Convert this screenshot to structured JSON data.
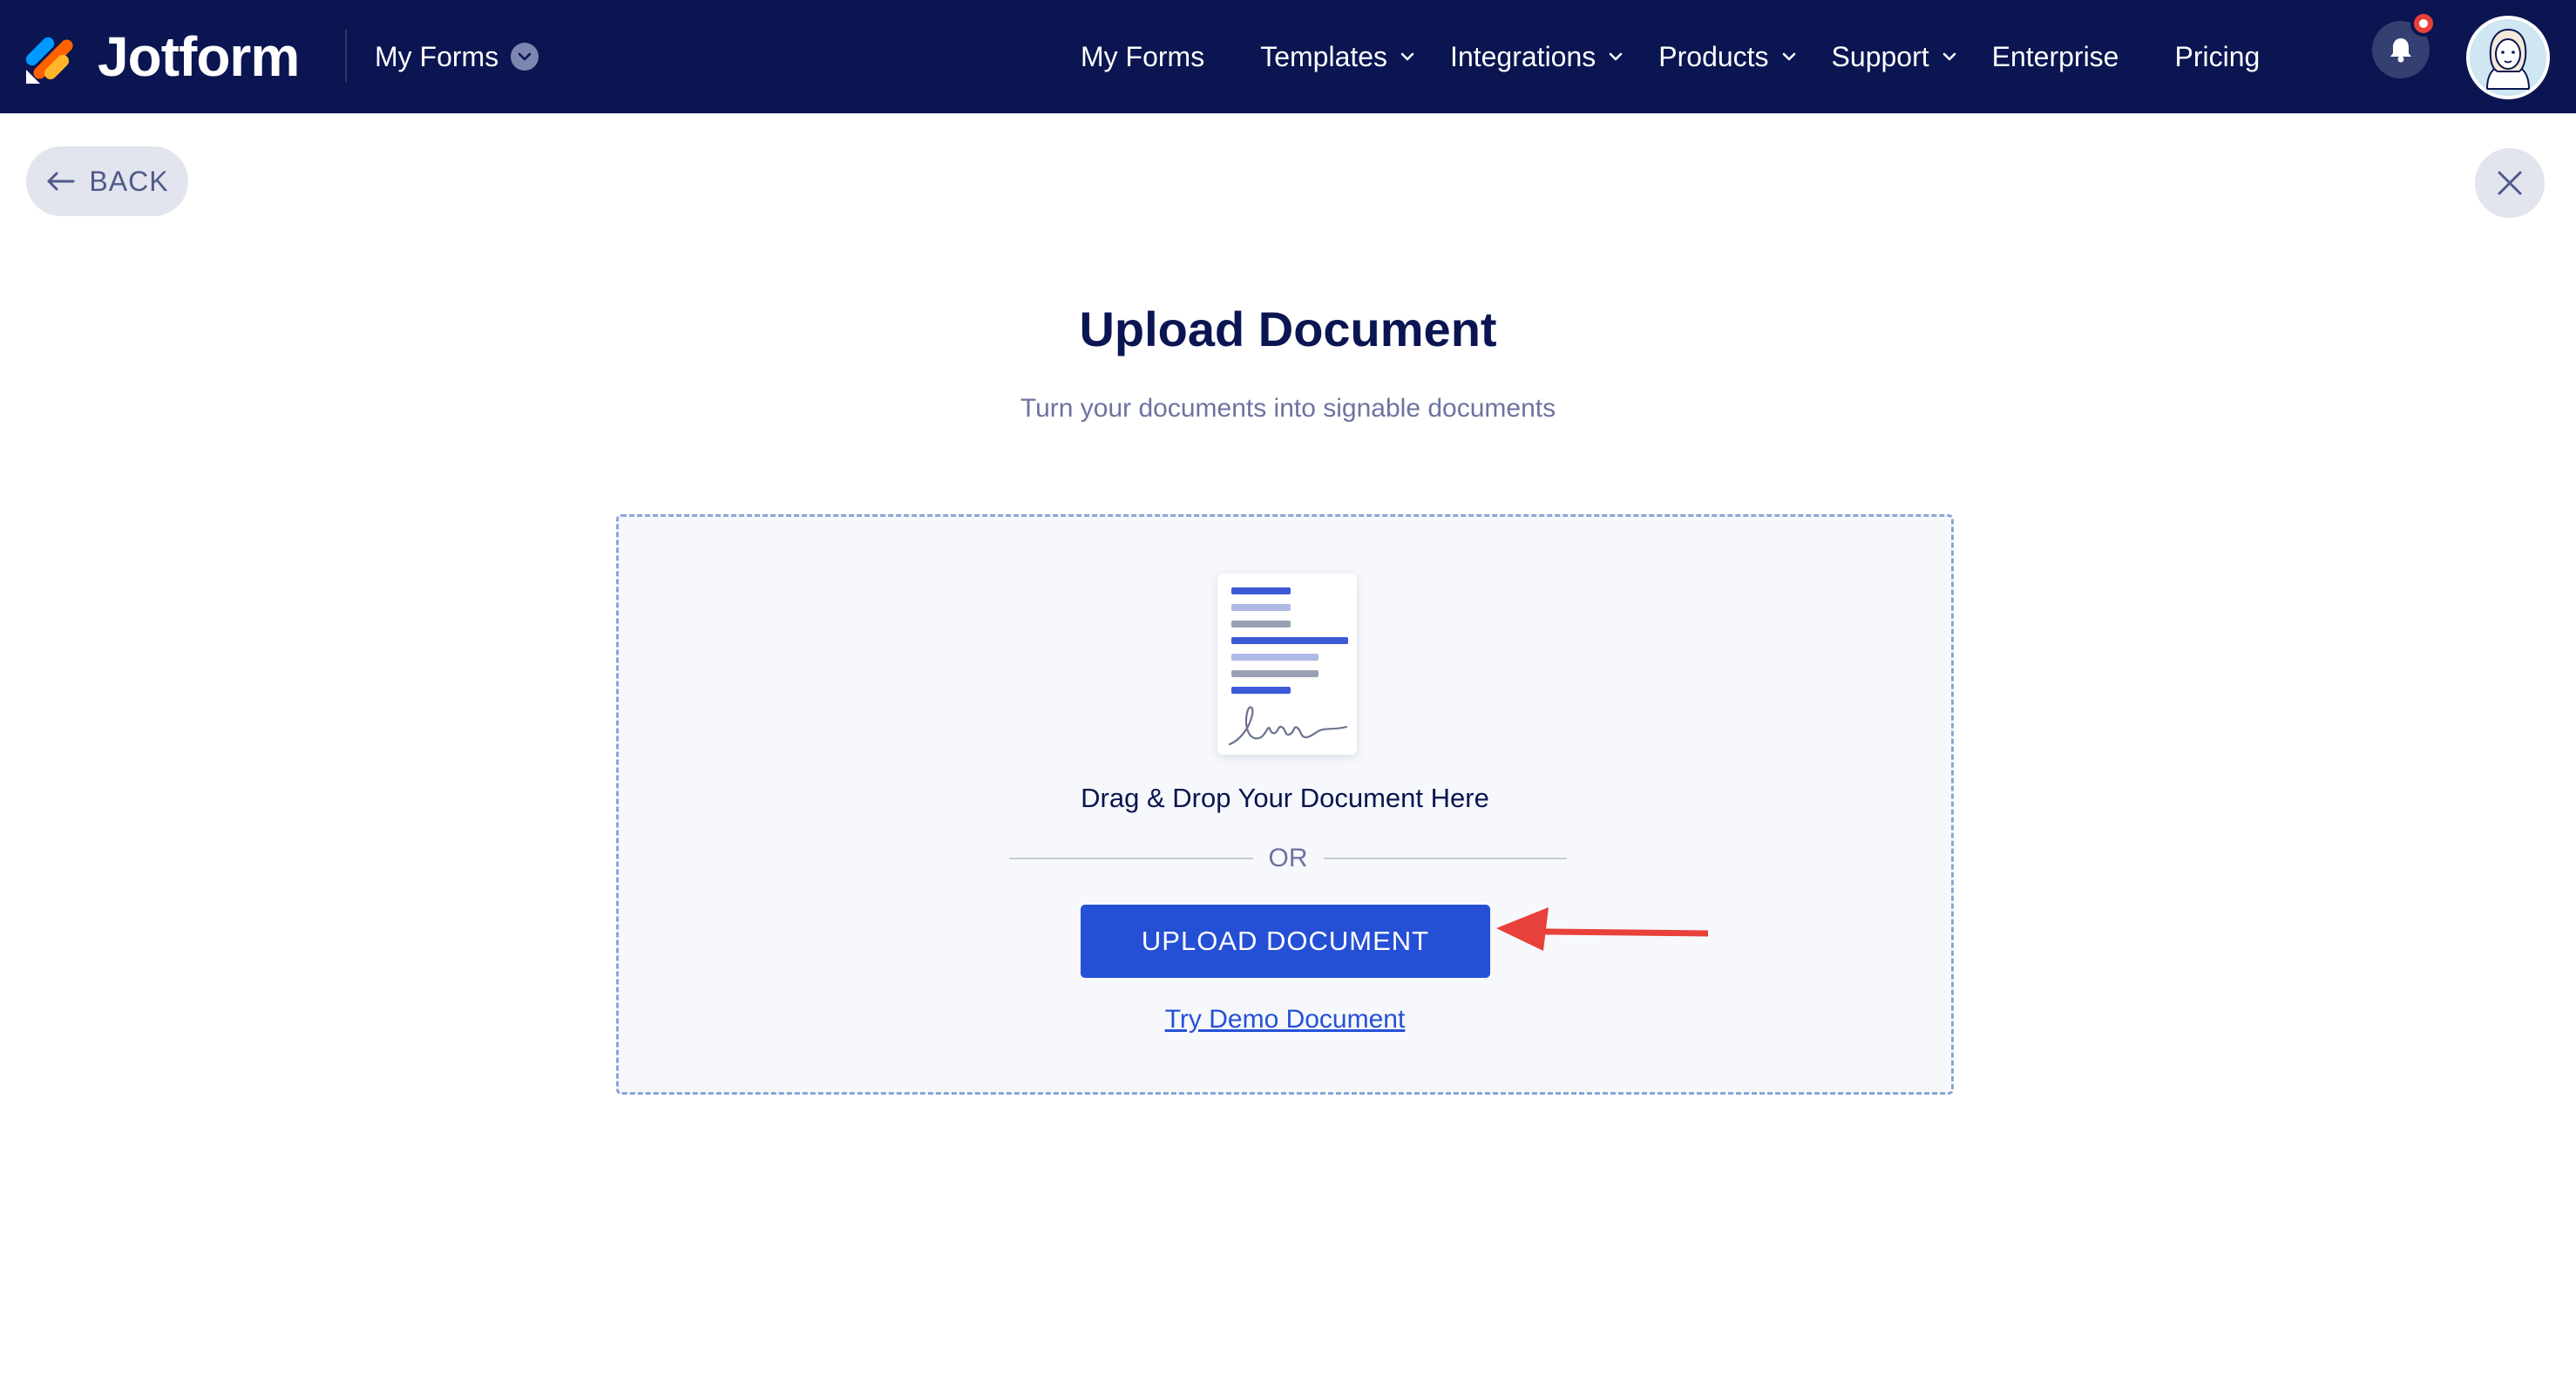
{
  "brand": {
    "name": "Jotform",
    "colors": {
      "navy": "#0a1551",
      "accent_blue": "#2550d6",
      "annotation_red": "#e8403a"
    }
  },
  "header": {
    "workspace_dropdown": "My Forms",
    "nav": [
      {
        "label": "My Forms",
        "has_dropdown": false
      },
      {
        "label": "Templates",
        "has_dropdown": true
      },
      {
        "label": "Integrations",
        "has_dropdown": true
      },
      {
        "label": "Products",
        "has_dropdown": true
      },
      {
        "label": "Support",
        "has_dropdown": true
      },
      {
        "label": "Enterprise",
        "has_dropdown": false
      },
      {
        "label": "Pricing",
        "has_dropdown": false
      }
    ],
    "icons": {
      "notifications": "bell-icon",
      "avatar": "user-avatar"
    }
  },
  "page": {
    "back_label": "BACK",
    "title": "Upload Document",
    "subtitle": "Turn your documents into signable documents"
  },
  "dropzone": {
    "drag_text": "Drag & Drop Your Document Here",
    "or_text": "OR",
    "upload_button": "UPLOAD DOCUMENT",
    "demo_link": "Try Demo Document"
  }
}
